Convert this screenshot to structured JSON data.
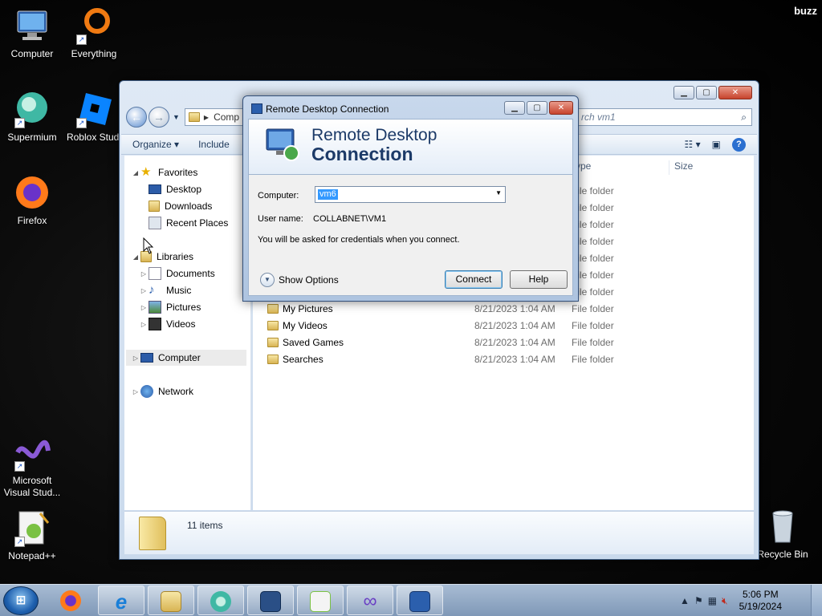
{
  "desktop": {
    "user_label": "buzz",
    "icons": [
      {
        "label": "Computer"
      },
      {
        "label": "Everything"
      },
      {
        "label": "Supermium"
      },
      {
        "label": "Roblox Studi"
      },
      {
        "label": "Firefox"
      },
      {
        "label": "Microsoft Visual Stud..."
      },
      {
        "label": "Notepad++"
      },
      {
        "label": "Recycle Bin"
      }
    ]
  },
  "explorer": {
    "address": "Comp",
    "search_placeholder": "rch vm1",
    "toolbar": {
      "organize": "Organize",
      "include": "Include"
    },
    "nav": {
      "favorites": "Favorites",
      "desktop": "Desktop",
      "downloads": "Downloads",
      "recent": "Recent Places",
      "libraries": "Libraries",
      "documents": "Documents",
      "music": "Music",
      "pictures": "Pictures",
      "videos": "Videos",
      "computer": "Computer",
      "network": "Network"
    },
    "columns": {
      "type": "ype",
      "size": "Size"
    },
    "rows": [
      {
        "name": "",
        "date": "",
        "type": "File folder"
      },
      {
        "name": "",
        "date": "",
        "type": "File folder"
      },
      {
        "name": "",
        "date": "",
        "type": "File folder"
      },
      {
        "name": "",
        "date": "",
        "type": "File folder"
      },
      {
        "name": "",
        "date": "",
        "type": "File folder"
      },
      {
        "name": "",
        "date": "",
        "type": "File folder"
      },
      {
        "name": "",
        "date": "",
        "type": "File folder"
      },
      {
        "name": "My Pictures",
        "date": "8/21/2023 1:04 AM",
        "type": "File folder"
      },
      {
        "name": "My Videos",
        "date": "8/21/2023 1:04 AM",
        "type": "File folder"
      },
      {
        "name": "Saved Games",
        "date": "8/21/2023 1:04 AM",
        "type": "File folder"
      },
      {
        "name": "Searches",
        "date": "8/21/2023 1:04 AM",
        "type": "File folder"
      }
    ],
    "status": "11 items"
  },
  "rdc": {
    "window_title": "Remote Desktop Connection",
    "banner_line1": "Remote Desktop",
    "banner_line2": "Connection",
    "computer_label": "Computer:",
    "computer_value": "vm6",
    "username_label": "User name:",
    "username_value": "COLLABNET\\VM1",
    "info": "You will be asked for credentials when you connect.",
    "show_options": "Show Options",
    "connect": "Connect",
    "help": "Help"
  },
  "taskbar": {
    "time": "5:06 PM",
    "date": "5/19/2024",
    "apps": [
      "firefox",
      "internet-explorer",
      "file-explorer",
      "supermium",
      "virtualbox",
      "notepad-plus-plus",
      "visual-studio",
      "remote-desktop"
    ]
  }
}
